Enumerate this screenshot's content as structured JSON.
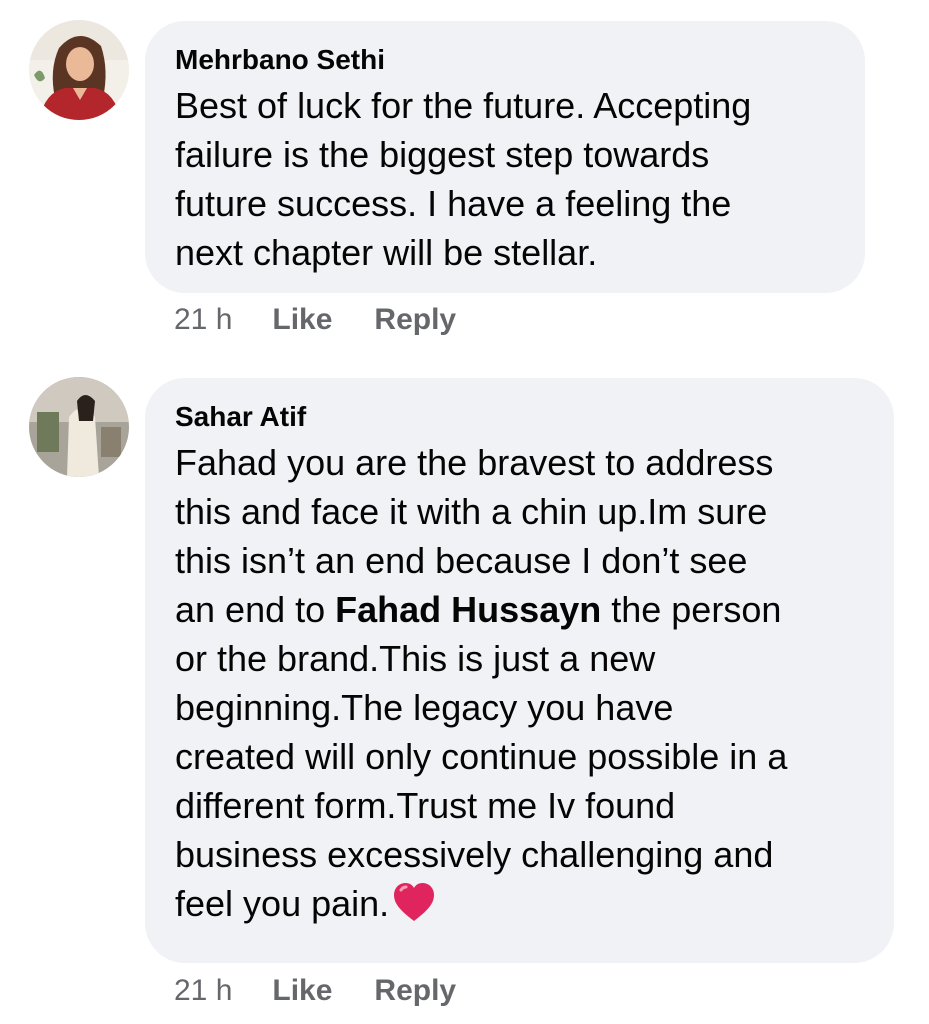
{
  "comments": [
    {
      "author": "Mehrbano Sethi",
      "text": "Best of luck for the future. Accepting\nfailure is the biggest step towards\nfuture success. I have a feeling the\nnext chapter will be stellar.",
      "time": "21 h",
      "like_label": "Like",
      "reply_label": "Reply"
    },
    {
      "author": "Sahar Atif",
      "text_before": "Fahad you are the bravest to address\nthis and face it with a chin up.Im sure\nthis isn’t an end because I don’t see\nan end to ",
      "text_mention": "Fahad Hussayn",
      "text_after": " the person\nor the brand.This is just a new\nbeginning.The legacy you have\ncreated will only continue possible in a\ndifferent form.Trust me Iv found\nbusiness excessively challenging and\nfeel you pain.",
      "emoji": "red-heart-icon",
      "time": "21 h",
      "like_label": "Like",
      "reply_label": "Reply"
    }
  ],
  "colors": {
    "bubble": "#f0f2f5",
    "meta_text": "#65676b",
    "heart": "#e0245e"
  }
}
